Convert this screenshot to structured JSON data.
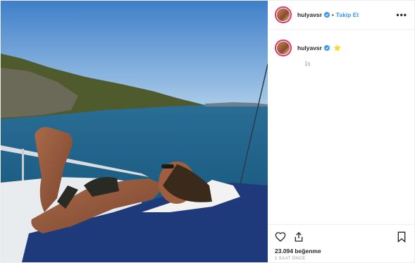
{
  "post": {
    "username": "hulyavsr",
    "separator": "•",
    "follow_label": "Takip Et",
    "more_label": "•••",
    "caption_emoji": "⭐",
    "time_ago": "1s",
    "likes_text": "23.094 beğenme",
    "timestamp": "1 SAAT ÖNCE"
  },
  "colors": {
    "follow": "#3897f0",
    "verified": "#3897f0",
    "ring": "#e1306c"
  },
  "icons": {
    "verified": "verified-badge-icon",
    "like": "heart-icon",
    "share": "share-icon",
    "save": "bookmark-icon"
  }
}
